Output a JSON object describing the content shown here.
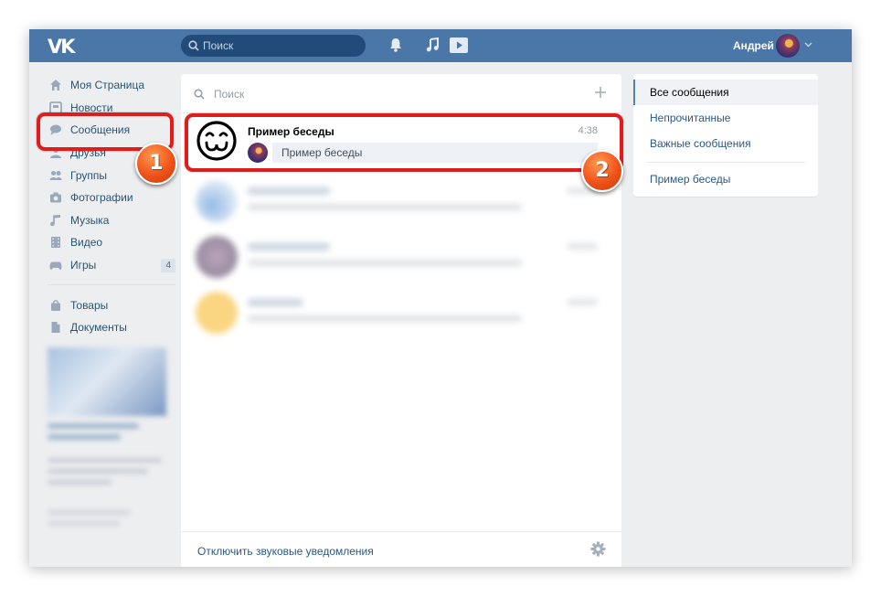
{
  "app": {
    "logo": "VK"
  },
  "topbar": {
    "search_placeholder": "Поиск",
    "icons": [
      "bell-icon",
      "music-icon",
      "video-play-icon"
    ],
    "user_name": "Андрей"
  },
  "sidebar": {
    "items": [
      {
        "label": "Моя Страница",
        "icon": "home-icon"
      },
      {
        "label": "Новости",
        "icon": "news-icon"
      },
      {
        "label": "Сообщения",
        "icon": "messages-icon"
      },
      {
        "label": "Друзья",
        "icon": "friends-icon"
      },
      {
        "label": "Группы",
        "icon": "groups-icon"
      },
      {
        "label": "Фотографии",
        "icon": "camera-icon"
      },
      {
        "label": "Музыка",
        "icon": "music-icon"
      },
      {
        "label": "Видео",
        "icon": "video-icon"
      },
      {
        "label": "Игры",
        "icon": "gamepad-icon",
        "badge": "4"
      }
    ],
    "items_secondary": [
      {
        "label": "Товары",
        "icon": "bag-icon"
      },
      {
        "label": "Документы",
        "icon": "document-icon"
      }
    ]
  },
  "messages": {
    "search_placeholder": "Поиск",
    "conversation": {
      "title": "Пример беседы",
      "time": "4:38",
      "preview": "Пример беседы"
    },
    "footer_link": "Отключить звуковые уведомления"
  },
  "filters": {
    "items": [
      "Все сообщения",
      "Непрочитанные",
      "Важные сообщения"
    ],
    "conversation": "Пример беседы"
  },
  "callouts": {
    "one": "1",
    "two": "2"
  },
  "colors": {
    "header": "#4a76a8",
    "highlight": "#e01d1d",
    "callout": "#f0531a"
  }
}
